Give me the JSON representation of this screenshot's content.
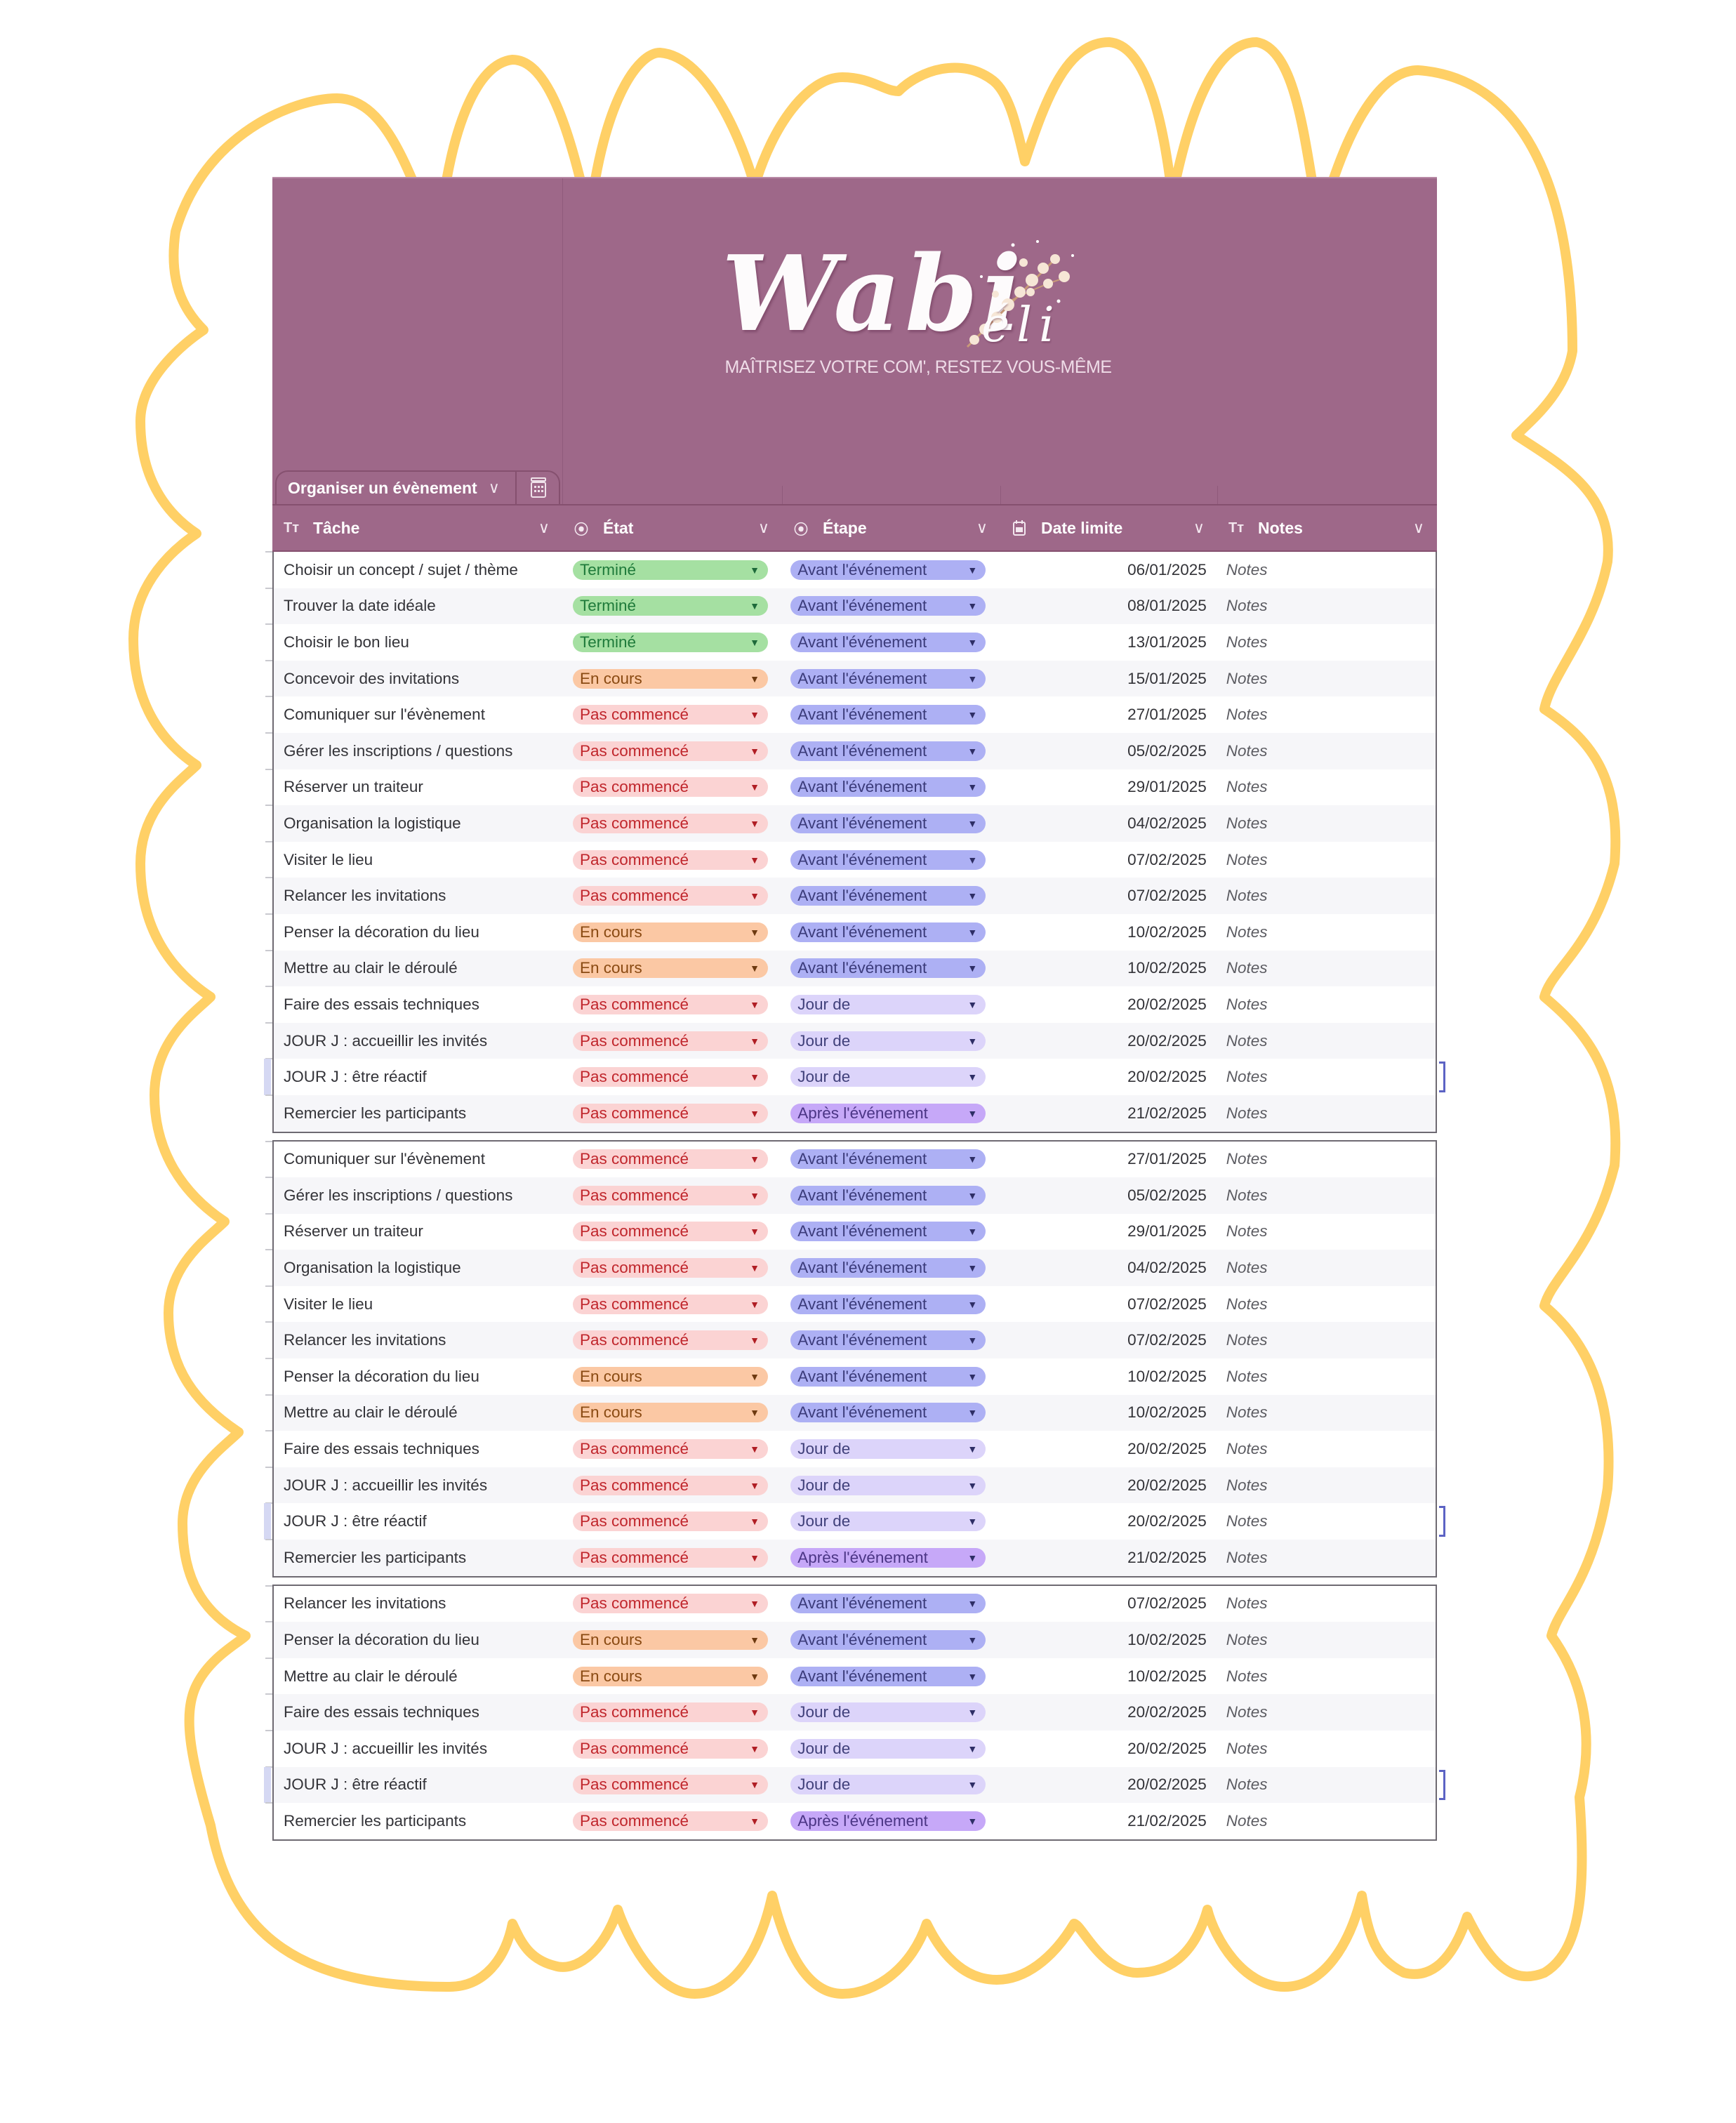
{
  "brand": {
    "name_main": "Wabi",
    "name_suffix": "éli",
    "tagline": "MAÎTRISEZ VOTRE COM', RESTEZ VOUS-MÊME"
  },
  "view_tab": {
    "label": "Organiser un évènement",
    "chevron_icon": "chevron-down-icon",
    "table_icon": "calendar-grid-icon"
  },
  "columns": [
    {
      "label": "Tâche",
      "icon": "text-type-icon"
    },
    {
      "label": "État",
      "icon": "dropdown-select-icon"
    },
    {
      "label": "Étape",
      "icon": "dropdown-select-icon"
    },
    {
      "label": "Date limite",
      "icon": "calendar-icon"
    },
    {
      "label": "Notes",
      "icon": "text-type-icon"
    }
  ],
  "colors": {
    "header_bg": "#9e6889",
    "frame_yellow": "#ffd066",
    "state_done": "#a5e0a2",
    "state_in_progress": "#fbc8a4",
    "state_not_started": "#fbd3d3",
    "step_before": "#adb0f4",
    "step_day": "#dcd4fa",
    "step_after": "#c6a8f8"
  },
  "blocks": [
    {
      "rows": [
        {
          "task": "Choisir un concept / sujet / thème",
          "state": "Terminé",
          "step": "Avant l'événement",
          "date": "06/01/2025",
          "notes": "Notes"
        },
        {
          "task": "Trouver la date idéale",
          "state": "Terminé",
          "step": "Avant l'événement",
          "date": "08/01/2025",
          "notes": "Notes"
        },
        {
          "task": "Choisir le bon lieu",
          "state": "Terminé",
          "step": "Avant l'événement",
          "date": "13/01/2025",
          "notes": "Notes"
        },
        {
          "task": "Concevoir des invitations",
          "state": "En cours",
          "step": "Avant l'événement",
          "date": "15/01/2025",
          "notes": "Notes"
        },
        {
          "task": "Comuniquer sur l'évènement",
          "state": "Pas commencé",
          "step": "Avant l'événement",
          "date": "27/01/2025",
          "notes": "Notes"
        },
        {
          "task": "Gérer les inscriptions / questions",
          "state": "Pas commencé",
          "step": "Avant l'événement",
          "date": "05/02/2025",
          "notes": "Notes"
        },
        {
          "task": "Réserver un traiteur",
          "state": "Pas commencé",
          "step": "Avant l'événement",
          "date": "29/01/2025",
          "notes": "Notes"
        },
        {
          "task": "Organisation la logistique",
          "state": "Pas commencé",
          "step": "Avant l'événement",
          "date": "04/02/2025",
          "notes": "Notes"
        },
        {
          "task": "Visiter le lieu",
          "state": "Pas commencé",
          "step": "Avant l'événement",
          "date": "07/02/2025",
          "notes": "Notes"
        },
        {
          "task": "Relancer les invitations",
          "state": "Pas commencé",
          "step": "Avant l'événement",
          "date": "07/02/2025",
          "notes": "Notes"
        },
        {
          "task": "Penser la décoration du lieu",
          "state": "En cours",
          "step": "Avant l'événement",
          "date": "10/02/2025",
          "notes": "Notes"
        },
        {
          "task": "Mettre au clair le déroulé",
          "state": "En cours",
          "step": "Avant l'événement",
          "date": "10/02/2025",
          "notes": "Notes"
        },
        {
          "task": "Faire des essais techniques",
          "state": "Pas commencé",
          "step": "Jour de",
          "date": "20/02/2025",
          "notes": "Notes"
        },
        {
          "task": "JOUR J : accueillir les invités",
          "state": "Pas commencé",
          "step": "Jour de",
          "date": "20/02/2025",
          "notes": "Notes"
        },
        {
          "task": "JOUR J :  être réactif",
          "state": "Pas commencé",
          "step": "Jour de",
          "date": "20/02/2025",
          "notes": "Notes",
          "selected": true
        },
        {
          "task": "Remercier les participants",
          "state": "Pas commencé",
          "step": "Après l'événement",
          "date": "21/02/2025",
          "notes": "Notes"
        }
      ]
    },
    {
      "rows": [
        {
          "task": "Comuniquer sur l'évènement",
          "state": "Pas commencé",
          "step": "Avant l'événement",
          "date": "27/01/2025",
          "notes": "Notes"
        },
        {
          "task": "Gérer les inscriptions / questions",
          "state": "Pas commencé",
          "step": "Avant l'événement",
          "date": "05/02/2025",
          "notes": "Notes"
        },
        {
          "task": "Réserver un traiteur",
          "state": "Pas commencé",
          "step": "Avant l'événement",
          "date": "29/01/2025",
          "notes": "Notes"
        },
        {
          "task": "Organisation la logistique",
          "state": "Pas commencé",
          "step": "Avant l'événement",
          "date": "04/02/2025",
          "notes": "Notes"
        },
        {
          "task": "Visiter le lieu",
          "state": "Pas commencé",
          "step": "Avant l'événement",
          "date": "07/02/2025",
          "notes": "Notes"
        },
        {
          "task": "Relancer les invitations",
          "state": "Pas commencé",
          "step": "Avant l'événement",
          "date": "07/02/2025",
          "notes": "Notes"
        },
        {
          "task": "Penser la décoration du lieu",
          "state": "En cours",
          "step": "Avant l'événement",
          "date": "10/02/2025",
          "notes": "Notes"
        },
        {
          "task": "Mettre au clair le déroulé",
          "state": "En cours",
          "step": "Avant l'événement",
          "date": "10/02/2025",
          "notes": "Notes"
        },
        {
          "task": "Faire des essais techniques",
          "state": "Pas commencé",
          "step": "Jour de",
          "date": "20/02/2025",
          "notes": "Notes"
        },
        {
          "task": "JOUR J : accueillir les invités",
          "state": "Pas commencé",
          "step": "Jour de",
          "date": "20/02/2025",
          "notes": "Notes"
        },
        {
          "task": "JOUR J :  être réactif",
          "state": "Pas commencé",
          "step": "Jour de",
          "date": "20/02/2025",
          "notes": "Notes",
          "selected": true
        },
        {
          "task": "Remercier les participants",
          "state": "Pas commencé",
          "step": "Après l'événement",
          "date": "21/02/2025",
          "notes": "Notes"
        }
      ]
    },
    {
      "rows": [
        {
          "task": "Relancer les invitations",
          "state": "Pas commencé",
          "step": "Avant l'événement",
          "date": "07/02/2025",
          "notes": "Notes"
        },
        {
          "task": "Penser la décoration du lieu",
          "state": "En cours",
          "step": "Avant l'événement",
          "date": "10/02/2025",
          "notes": "Notes"
        },
        {
          "task": "Mettre au clair le déroulé",
          "state": "En cours",
          "step": "Avant l'événement",
          "date": "10/02/2025",
          "notes": "Notes"
        },
        {
          "task": "Faire des essais techniques",
          "state": "Pas commencé",
          "step": "Jour de",
          "date": "20/02/2025",
          "notes": "Notes"
        },
        {
          "task": "JOUR J : accueillir les invités",
          "state": "Pas commencé",
          "step": "Jour de",
          "date": "20/02/2025",
          "notes": "Notes"
        },
        {
          "task": "JOUR J :  être réactif",
          "state": "Pas commencé",
          "step": "Jour de",
          "date": "20/02/2025",
          "notes": "Notes",
          "selected": true
        },
        {
          "task": "Remercier les participants",
          "state": "Pas commencé",
          "step": "Après l'événement",
          "date": "21/02/2025",
          "notes": "Notes"
        }
      ]
    }
  ]
}
